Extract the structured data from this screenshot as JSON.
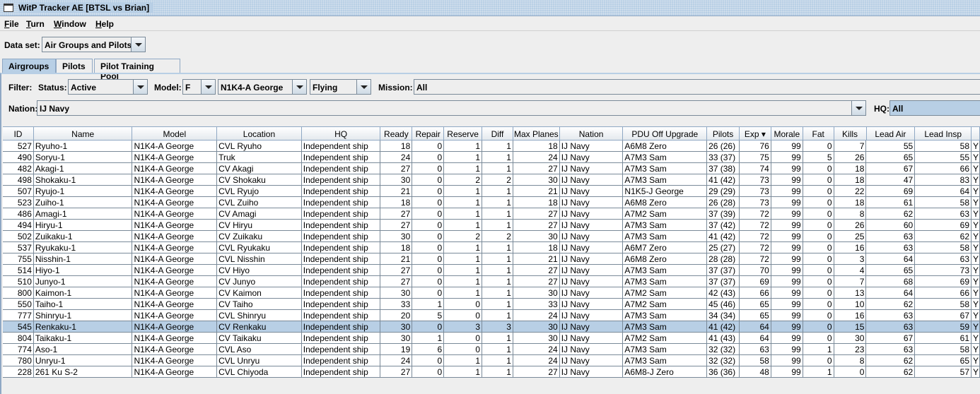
{
  "window": {
    "title": "WitP Tracker AE [BTSL vs Brian]",
    "icon": "window-icon"
  },
  "menu": [
    "File",
    "Turn",
    "Window",
    "Help"
  ],
  "dataset": {
    "label": "Data set:",
    "value": "Air Groups and Pilots"
  },
  "tabs": [
    {
      "label": "Airgroups",
      "active": true
    },
    {
      "label": "Pilots"
    },
    {
      "label": "Pilot Training Pool"
    }
  ],
  "filter": {
    "label": "Filter:",
    "status_label": "Status:",
    "status": "Active",
    "model_label": "Model:",
    "model_type": "F",
    "model": "N1K4-A George",
    "flying": "Flying",
    "mission_label": "Mission:",
    "mission": "All",
    "nation_label": "Nation:",
    "nation": "IJ Navy",
    "hq_label": "HQ:",
    "hq": "All"
  },
  "table": {
    "columns": [
      "ID",
      "Name",
      "Model",
      "Location",
      "HQ",
      "Ready",
      "Repair",
      "Reserve",
      "Diff",
      "Max Planes",
      "Nation",
      "PDU Off Upgrade",
      "Pilots",
      "Exp ▾",
      "Morale",
      "Fat",
      "Kills",
      "Lead Air",
      "Lead Insp",
      ""
    ],
    "sort_column": "Exp",
    "sort_direction": "descending",
    "selected_id": "545",
    "rows": [
      [
        "527",
        "Ryuho-1",
        "N1K4-A George",
        "CVL Ryuho",
        "Independent ship",
        "18",
        "0",
        "1",
        "1",
        "18",
        "IJ Navy",
        "A6M8 Zero",
        "26 (26)",
        "76",
        "99",
        "0",
        "7",
        "55",
        "58",
        "Y"
      ],
      [
        "490",
        "Soryu-1",
        "N1K4-A George",
        "Truk",
        "Independent ship",
        "24",
        "0",
        "1",
        "1",
        "24",
        "IJ Navy",
        "A7M3 Sam",
        "33 (37)",
        "75",
        "99",
        "5",
        "26",
        "65",
        "55",
        "Y"
      ],
      [
        "482",
        "Akagi-1",
        "N1K4-A George",
        "CV Akagi",
        "Independent ship",
        "27",
        "0",
        "1",
        "1",
        "27",
        "IJ Navy",
        "A7M3 Sam",
        "37 (38)",
        "74",
        "99",
        "0",
        "18",
        "67",
        "66",
        "Y"
      ],
      [
        "498",
        "Shokaku-1",
        "N1K4-A George",
        "CV Shokaku",
        "Independent ship",
        "30",
        "0",
        "2",
        "2",
        "30",
        "IJ Navy",
        "A7M3 Sam",
        "41 (42)",
        "73",
        "99",
        "0",
        "18",
        "47",
        "83",
        "Y"
      ],
      [
        "507",
        "Ryujo-1",
        "N1K4-A George",
        "CVL Ryujo",
        "Independent ship",
        "21",
        "0",
        "1",
        "1",
        "21",
        "IJ Navy",
        "N1K5-J George",
        "29 (29)",
        "73",
        "99",
        "0",
        "22",
        "69",
        "64",
        "Y"
      ],
      [
        "523",
        "Zuiho-1",
        "N1K4-A George",
        "CVL Zuiho",
        "Independent ship",
        "18",
        "0",
        "1",
        "1",
        "18",
        "IJ Navy",
        "A6M8 Zero",
        "26 (28)",
        "73",
        "99",
        "0",
        "18",
        "61",
        "58",
        "Y"
      ],
      [
        "486",
        "Amagi-1",
        "N1K4-A George",
        "CV Amagi",
        "Independent ship",
        "27",
        "0",
        "1",
        "1",
        "27",
        "IJ Navy",
        "A7M2 Sam",
        "37 (39)",
        "72",
        "99",
        "0",
        "8",
        "62",
        "63",
        "Y"
      ],
      [
        "494",
        "Hiryu-1",
        "N1K4-A George",
        "CV Hiryu",
        "Independent ship",
        "27",
        "0",
        "1",
        "1",
        "27",
        "IJ Navy",
        "A7M3 Sam",
        "37 (42)",
        "72",
        "99",
        "0",
        "26",
        "60",
        "69",
        "Y"
      ],
      [
        "502",
        "Zuikaku-1",
        "N1K4-A George",
        "CV Zuikaku",
        "Independent ship",
        "30",
        "0",
        "2",
        "2",
        "30",
        "IJ Navy",
        "A7M3 Sam",
        "41 (42)",
        "72",
        "99",
        "0",
        "25",
        "63",
        "62",
        "Y"
      ],
      [
        "537",
        "Ryukaku-1",
        "N1K4-A George",
        "CVL Ryukaku",
        "Independent ship",
        "18",
        "0",
        "1",
        "1",
        "18",
        "IJ Navy",
        "A6M7 Zero",
        "25 (27)",
        "72",
        "99",
        "0",
        "16",
        "63",
        "58",
        "Y"
      ],
      [
        "755",
        "Nisshin-1",
        "N1K4-A George",
        "CVL Nisshin",
        "Independent ship",
        "21",
        "0",
        "1",
        "1",
        "21",
        "IJ Navy",
        "A6M8 Zero",
        "28 (28)",
        "72",
        "99",
        "0",
        "3",
        "64",
        "63",
        "Y"
      ],
      [
        "514",
        "Hiyo-1",
        "N1K4-A George",
        "CV Hiyo",
        "Independent ship",
        "27",
        "0",
        "1",
        "1",
        "27",
        "IJ Navy",
        "A7M3 Sam",
        "37 (37)",
        "70",
        "99",
        "0",
        "4",
        "65",
        "73",
        "Y"
      ],
      [
        "510",
        "Junyo-1",
        "N1K4-A George",
        "CV Junyo",
        "Independent ship",
        "27",
        "0",
        "1",
        "1",
        "27",
        "IJ Navy",
        "A7M3 Sam",
        "37 (37)",
        "69",
        "99",
        "0",
        "7",
        "68",
        "69",
        "Y"
      ],
      [
        "800",
        "Kaimon-1",
        "N1K4-A George",
        "CV Kaimon",
        "Independent ship",
        "30",
        "0",
        "1",
        "1",
        "30",
        "IJ Navy",
        "A7M2 Sam",
        "42 (43)",
        "66",
        "99",
        "0",
        "13",
        "64",
        "66",
        "Y"
      ],
      [
        "550",
        "Taiho-1",
        "N1K4-A George",
        "CV Taiho",
        "Independent ship",
        "33",
        "1",
        "0",
        "1",
        "33",
        "IJ Navy",
        "A7M2 Sam",
        "45 (46)",
        "65",
        "99",
        "0",
        "10",
        "62",
        "58",
        "Y"
      ],
      [
        "777",
        "Shinryu-1",
        "N1K4-A George",
        "CVL Shinryu",
        "Independent ship",
        "20",
        "5",
        "0",
        "1",
        "24",
        "IJ Navy",
        "A7M3 Sam",
        "34 (34)",
        "65",
        "99",
        "0",
        "16",
        "63",
        "67",
        "Y"
      ],
      [
        "545",
        "Renkaku-1",
        "N1K4-A George",
        "CV Renkaku",
        "Independent ship",
        "30",
        "0",
        "3",
        "3",
        "30",
        "IJ Navy",
        "A7M3 Sam",
        "41 (42)",
        "64",
        "99",
        "0",
        "15",
        "63",
        "59",
        "Y"
      ],
      [
        "804",
        "Taikaku-1",
        "N1K4-A George",
        "CV Taikaku",
        "Independent ship",
        "30",
        "1",
        "0",
        "1",
        "30",
        "IJ Navy",
        "A7M2 Sam",
        "41 (43)",
        "64",
        "99",
        "0",
        "30",
        "67",
        "61",
        "Y"
      ],
      [
        "774",
        "Aso-1",
        "N1K4-A George",
        "CVL Aso",
        "Independent ship",
        "19",
        "6",
        "0",
        "1",
        "24",
        "IJ Navy",
        "A7M3 Sam",
        "32 (32)",
        "63",
        "99",
        "1",
        "23",
        "63",
        "58",
        "Y"
      ],
      [
        "780",
        "Unryu-1",
        "N1K4-A George",
        "CVL Unryu",
        "Independent ship",
        "24",
        "0",
        "1",
        "1",
        "24",
        "IJ Navy",
        "A7M3 Sam",
        "32 (32)",
        "58",
        "99",
        "0",
        "8",
        "62",
        "65",
        "Y"
      ],
      [
        "228",
        "261 Ku S-2",
        "N1K4-A George",
        "CVL Chiyoda",
        "Independent ship",
        "27",
        "0",
        "1",
        "1",
        "27",
        "IJ Navy",
        "A6M8-J Zero",
        "36 (36)",
        "48",
        "99",
        "1",
        "0",
        "62",
        "57",
        "Y"
      ]
    ]
  }
}
